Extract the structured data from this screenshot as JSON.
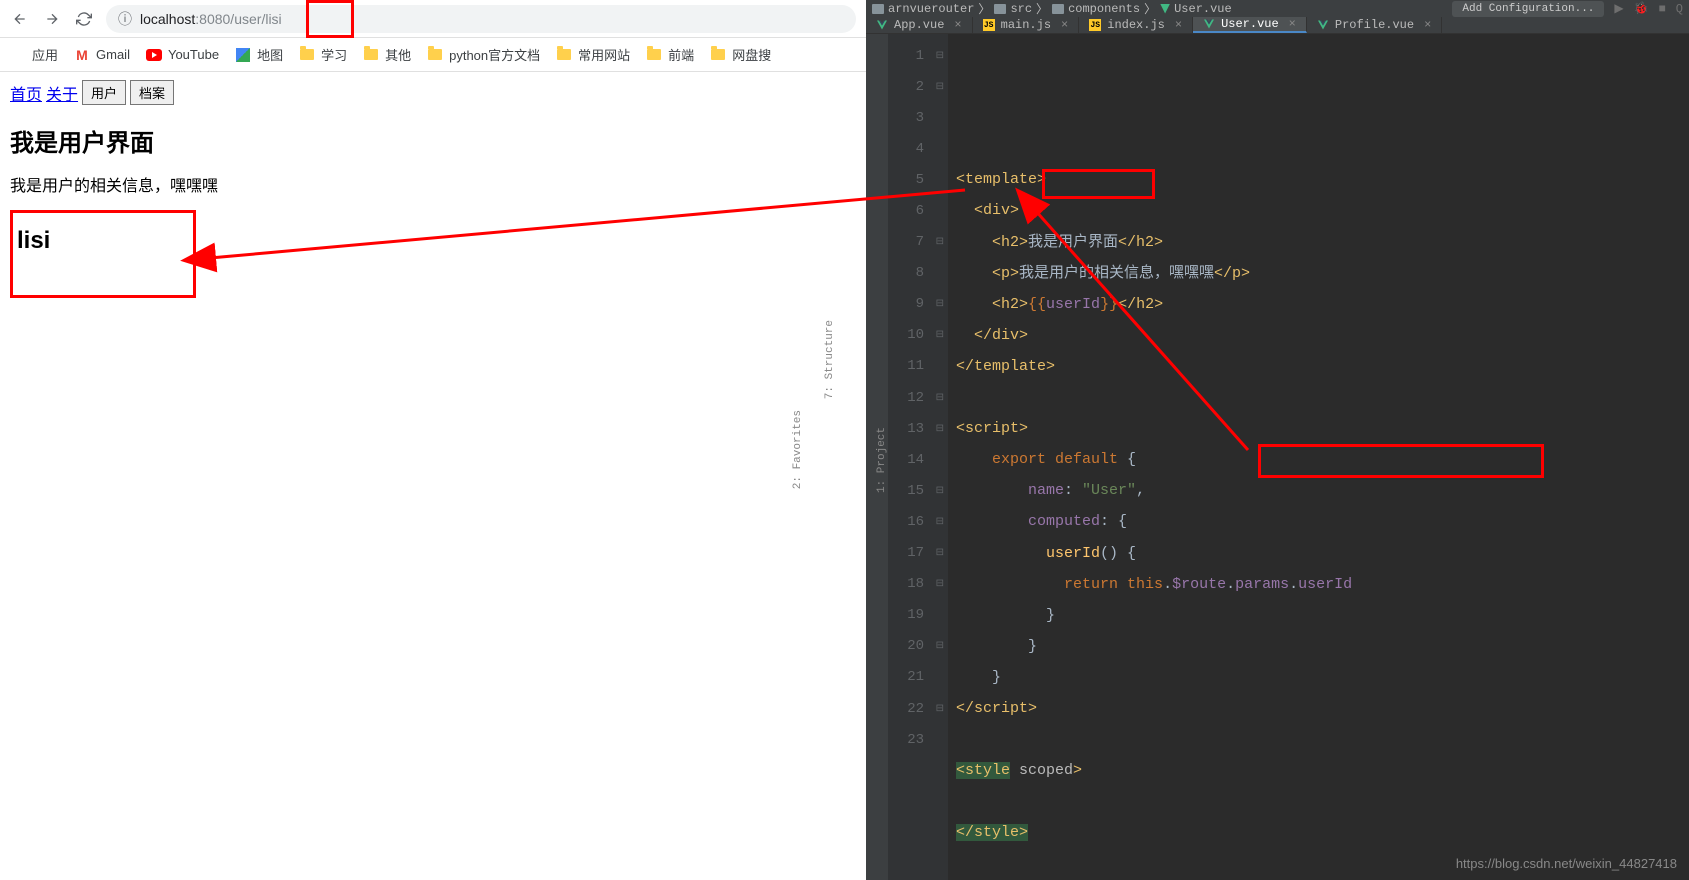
{
  "browser": {
    "url_prefix": "localhost",
    "url_mid": ":8080/user",
    "url_suffix": "/lisi",
    "bookmarks": [
      {
        "label": "应用",
        "icon": "apps"
      },
      {
        "label": "Gmail",
        "icon": "gmail"
      },
      {
        "label": "YouTube",
        "icon": "youtube"
      },
      {
        "label": "地图",
        "icon": "maps"
      },
      {
        "label": "学习",
        "icon": "folder"
      },
      {
        "label": "其他",
        "icon": "folder"
      },
      {
        "label": "python官方文档",
        "icon": "folder"
      },
      {
        "label": "常用网站",
        "icon": "folder"
      },
      {
        "label": "前端",
        "icon": "folder"
      },
      {
        "label": "网盘搜",
        "icon": "folder"
      }
    ]
  },
  "page": {
    "nav": {
      "home": "首页",
      "about": "关于",
      "user_btn": "用户",
      "archive_btn": "档案"
    },
    "heading": "我是用户界面",
    "paragraph": "我是用户的相关信息，嘿嘿嘿",
    "userid_display": "lisi"
  },
  "ide": {
    "breadcrumb": [
      "arnvuerouter",
      "src",
      "components",
      "User.vue"
    ],
    "add_config": "Add Configuration...",
    "tabs": [
      {
        "label": "App.vue",
        "type": "vue"
      },
      {
        "label": "main.js",
        "type": "js"
      },
      {
        "label": "index.js",
        "type": "js"
      },
      {
        "label": "User.vue",
        "type": "vue",
        "active": true
      },
      {
        "label": "Profile.vue",
        "type": "vue"
      }
    ],
    "side_tools": {
      "project": "1: Project",
      "structure": "7: Structure",
      "favorites": "2: Favorites"
    },
    "code_lines": [
      {
        "n": 1,
        "html": "<span class='c-tag'>&lt;template&gt;</span>"
      },
      {
        "n": 2,
        "html": "  <span class='c-tag'>&lt;div&gt;</span>"
      },
      {
        "n": 3,
        "html": "    <span class='c-tag'>&lt;h2&gt;</span><span class='c-text'>我是用户界面</span><span class='c-tag'>&lt;/h2&gt;</span>"
      },
      {
        "n": 4,
        "html": "    <span class='c-tag'>&lt;p&gt;</span><span class='c-text'>我是用户的相关信息，嘿嘿嘿</span><span class='c-tag'>&lt;/p&gt;</span>"
      },
      {
        "n": 5,
        "html": "    <span class='c-tag'>&lt;h2&gt;</span><span class='c-tmpl'>{{</span><span class='c-var'>userId</span><span class='c-tmpl'>}}</span><span class='c-tag'>&lt;/h2&gt;</span>"
      },
      {
        "n": 6,
        "html": "  <span class='c-tag'>&lt;/div&gt;</span>"
      },
      {
        "n": 7,
        "html": "<span class='c-tag'>&lt;/template&gt;</span>"
      },
      {
        "n": 8,
        "html": ""
      },
      {
        "n": 9,
        "html": "<span class='c-tag'>&lt;script&gt;</span>"
      },
      {
        "n": 10,
        "html": "    <span class='c-kw'>export default </span><span class='c-text'>{</span>"
      },
      {
        "n": 11,
        "html": "        <span class='c-var'>name</span><span class='c-text'>: </span><span class='c-str'>\"User\"</span><span class='c-text'>,</span>"
      },
      {
        "n": 12,
        "html": "        <span class='c-var'>computed</span><span class='c-text'>: {</span>"
      },
      {
        "n": 13,
        "html": "          <span class='c-func'>userId</span><span class='c-text'>() {</span>"
      },
      {
        "n": 14,
        "html": "            <span class='c-kw'>return </span><span class='c-kw'>this</span><span class='c-text'>.</span><span class='c-var'>$route</span><span class='c-text'>.</span><span class='c-var'>params</span><span class='c-text'>.</span><span class='c-var'>userId</span>"
      },
      {
        "n": 15,
        "html": "          <span class='c-text'>}</span>"
      },
      {
        "n": 16,
        "html": "        <span class='c-text'>}</span>"
      },
      {
        "n": 17,
        "html": "    <span class='c-text'>}</span>"
      },
      {
        "n": 18,
        "html": "<span class='c-tag'>&lt;/script&gt;</span>"
      },
      {
        "n": 19,
        "html": ""
      },
      {
        "n": 20,
        "html": "<span class='c-tag hl-bg2'>&lt;style</span> <span class='c-attr'>scoped</span><span class='c-tag'>&gt;</span>"
      },
      {
        "n": 21,
        "html": ""
      },
      {
        "n": 22,
        "html": "<span class='c-tag hl-bg2'>&lt;/style&gt;</span>"
      },
      {
        "n": 23,
        "html": ""
      }
    ],
    "watermark": "https://blog.csdn.net/weixin_44827418"
  }
}
